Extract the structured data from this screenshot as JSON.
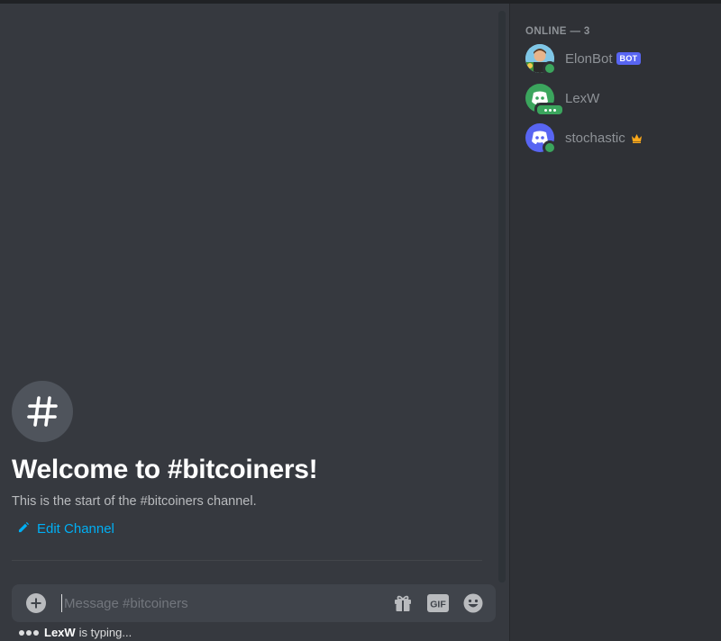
{
  "channel": {
    "welcome_title": "Welcome to #bitcoiners!",
    "welcome_subtitle": "This is the start of the #bitcoiners channel.",
    "edit_label": "Edit Channel",
    "icon": "hash-icon"
  },
  "composer": {
    "placeholder": "Message #bitcoiners",
    "value": "",
    "gif_label": "GIF",
    "icons": [
      "plus-circle-icon",
      "gift-icon",
      "gif-icon",
      "emoji-icon"
    ]
  },
  "typing": {
    "user": "LexW",
    "text": "is typing..."
  },
  "members": {
    "section_label": "ONLINE — 3",
    "items": [
      {
        "name": "ElonBot",
        "badge": "BOT",
        "status": "online"
      },
      {
        "name": "LexW",
        "status": "typing"
      },
      {
        "name": "stochastic",
        "status": "online",
        "icon": "crown-icon"
      }
    ]
  },
  "colors": {
    "accent": "#5865f2",
    "link": "#00aff4",
    "online": "#3ba55d",
    "owner_crown": "#faa81a"
  }
}
